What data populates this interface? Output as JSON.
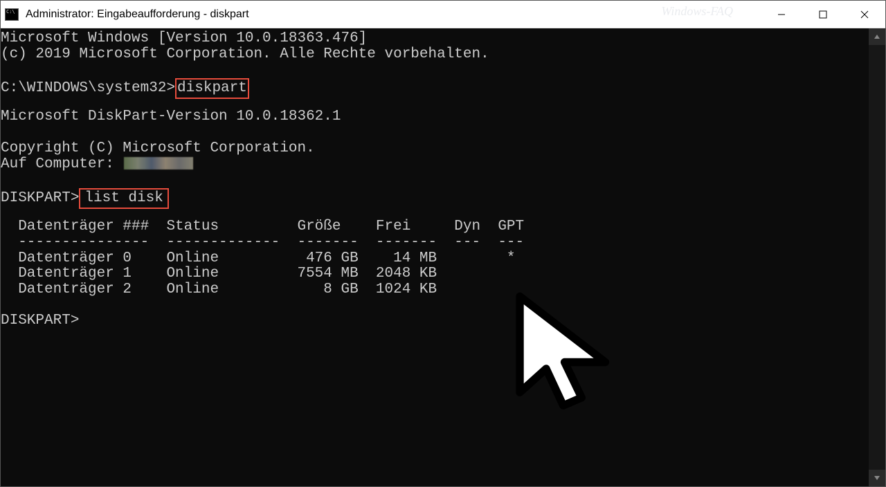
{
  "window": {
    "title": "Administrator: Eingabeaufforderung - diskpart",
    "watermark": "Windows-FAQ"
  },
  "terminal": {
    "line1": "Microsoft Windows [Version 10.0.18363.476]",
    "line2": "(c) 2019 Microsoft Corporation. Alle Rechte vorbehalten.",
    "prompt1_prefix": "C:\\WINDOWS\\system32>",
    "prompt1_cmd": "diskpart",
    "dp_version": "Microsoft DiskPart-Version 10.0.18362.1",
    "copyright": "Copyright (C) Microsoft Corporation.",
    "on_computer_label": "Auf Computer: ",
    "prompt2_prefix": "DISKPART>",
    "prompt2_cmd": "list disk",
    "table_header": "  Datenträger ###  Status         Größe    Frei     Dyn  GPT",
    "table_sep": "  ---------------  -------------  -------  -------  ---  ---",
    "rows": [
      "  Datenträger 0    Online          476 GB    14 MB        *",
      "  Datenträger 1    Online         7554 MB  2048 KB",
      "  Datenträger 2    Online            8 GB  1024 KB"
    ],
    "prompt3": "DISKPART>"
  },
  "chart_data": {
    "type": "table",
    "title": "list disk",
    "columns": [
      "Datenträger ###",
      "Status",
      "Größe",
      "Frei",
      "Dyn",
      "GPT"
    ],
    "rows": [
      [
        "Datenträger 0",
        "Online",
        "476 GB",
        "14 MB",
        "",
        "*"
      ],
      [
        "Datenträger 1",
        "Online",
        "7554 MB",
        "2048 KB",
        "",
        ""
      ],
      [
        "Datenträger 2",
        "Online",
        "8 GB",
        "1024 KB",
        "",
        ""
      ]
    ]
  }
}
